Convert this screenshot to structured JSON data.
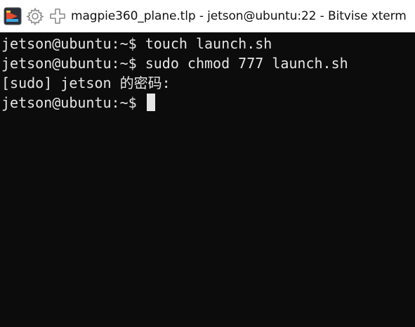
{
  "window": {
    "title": "magpie360_plane.tlp - jetson@ubuntu:22 - Bitvise xterm",
    "icons": [
      "bitvise-app-icon",
      "gear-icon",
      "plus-icon"
    ]
  },
  "terminal": {
    "lines": [
      {
        "prompt": "jetson@ubuntu:~$",
        "command": " touch launch.sh"
      },
      {
        "prompt": "jetson@ubuntu:~$",
        "command": " sudo chmod 777 launch.sh"
      },
      {
        "prompt": "",
        "command": "[sudo] jetson 的密码:"
      },
      {
        "prompt": "jetson@ubuntu:~$",
        "command": " "
      }
    ],
    "colors": {
      "background": "#0c0c0c",
      "foreground": "#e6e6e6"
    }
  }
}
